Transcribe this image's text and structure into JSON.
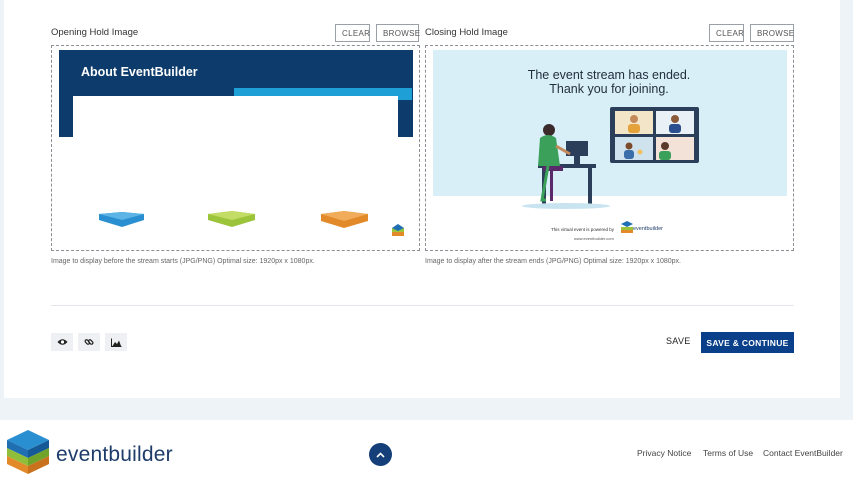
{
  "opening": {
    "label": "Opening Hold Image",
    "clear_label": "CLEAR",
    "browse_label": "BROWSE",
    "preview_title": "About EventBuilder",
    "help": "Image to display before the stream starts (JPG/PNG) Optimal size: 1920px x 1080px."
  },
  "closing": {
    "label": "Closing Hold Image",
    "clear_label": "CLEAR",
    "browse_label": "BROWSE",
    "preview_line1": "The event stream has ended.",
    "preview_line2": "Thank you for joining.",
    "preview_powered": "This virtual event is powered by",
    "preview_brand": "eventbuilder",
    "preview_url": "www.eventbuilder.com",
    "help": "Image to display after the stream ends (JPG/PNG) Optimal size: 1920px x 1080px."
  },
  "toolbar": {
    "icons": [
      "eye-icon",
      "link-icon",
      "image-icon"
    ],
    "save_label": "SAVE",
    "save_continue_label": "SAVE & CONTINUE"
  },
  "footer": {
    "brand": "eventbuilder",
    "links": [
      "Privacy Notice",
      "Terms of Use",
      "Contact EventBuilder"
    ]
  },
  "colors": {
    "primary": "#0a3f8a",
    "brand_navy": "#153f78",
    "banner_blue": "#0d3b6b",
    "accent_cyan": "#1e9fd6",
    "background": "#eef3f8"
  }
}
